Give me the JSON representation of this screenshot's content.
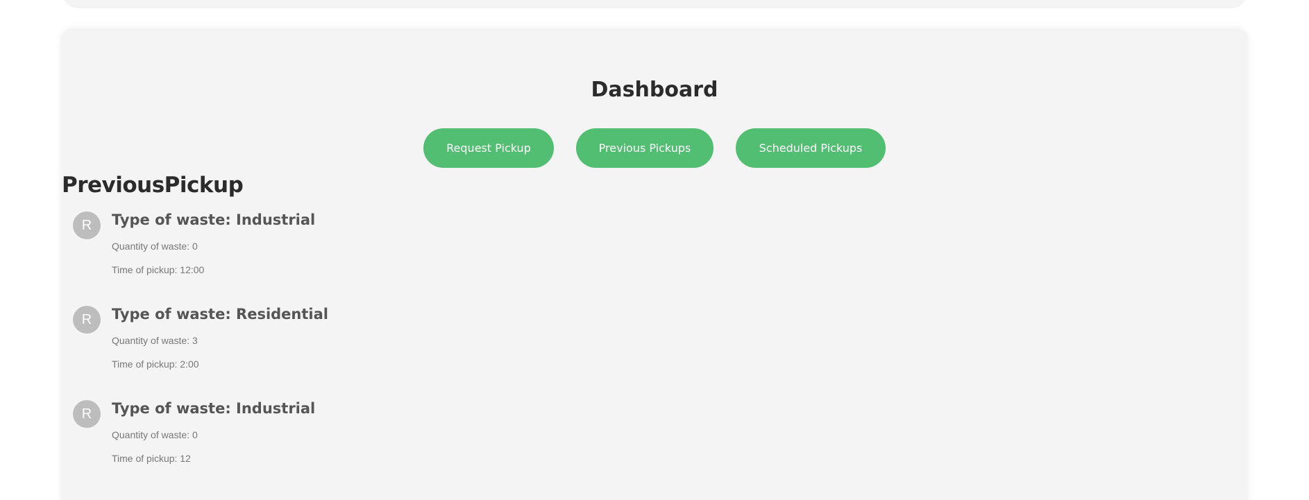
{
  "dashboard": {
    "title": "Dashboard",
    "buttons": {
      "request_pickup": "Request Pickup",
      "previous_pickups": "Previous Pickups",
      "scheduled_pickups": "Scheduled Pickups"
    }
  },
  "section": {
    "title": "PreviousPickup"
  },
  "pickups": [
    {
      "avatar": "R",
      "type": "Type of waste: Industrial",
      "quantity": "Quantity of waste: 0",
      "time": "Time of pickup: 12:00"
    },
    {
      "avatar": "R",
      "type": "Type of waste: Residential",
      "quantity": "Quantity of waste: 3",
      "time": "Time of pickup: 2:00"
    },
    {
      "avatar": "R",
      "type": "Type of waste: Industrial",
      "quantity": "Quantity of waste: 0",
      "time": "Time of pickup: 12"
    }
  ],
  "colors": {
    "accent": "#52be72",
    "card_background": "#f4f4f4",
    "avatar_background": "#bdbdbd"
  }
}
